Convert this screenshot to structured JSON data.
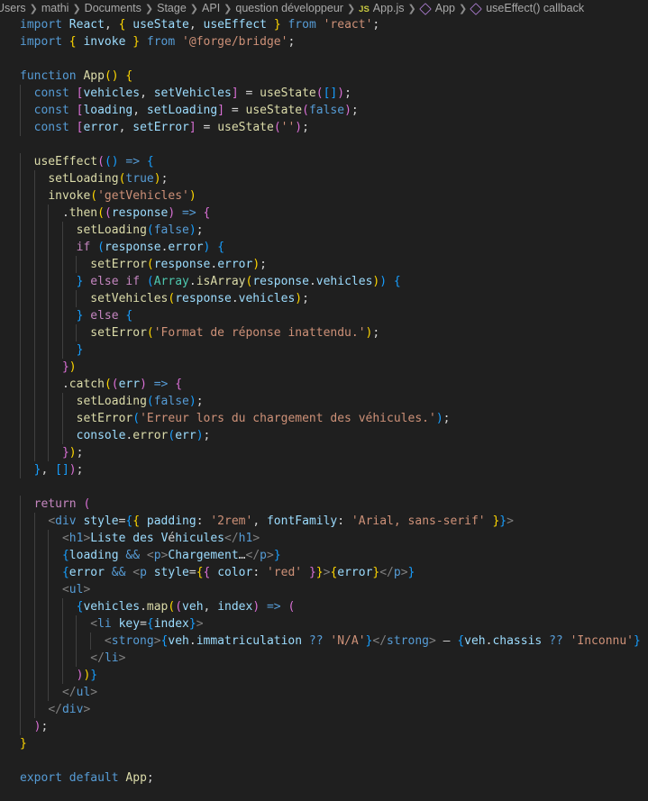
{
  "breadcrumb": {
    "items": [
      "Users",
      "mathi",
      "Documents",
      "Stage",
      "API",
      "question développeur"
    ],
    "file_badge": "JS",
    "file_name": "App.js",
    "symbols": [
      "App",
      "useEffect() callback"
    ]
  },
  "code": {
    "lines": [
      "import React, { useState, useEffect } from 'react';",
      "import { invoke } from '@forge/bridge';",
      "",
      "function App() {",
      "  const [vehicles, setVehicles] = useState([]);",
      "  const [loading, setLoading] = useState(false);",
      "  const [error, setError] = useState('');",
      "",
      "  useEffect(() => {",
      "    setLoading(true);",
      "    invoke('getVehicles')",
      "      .then((response) => {",
      "        setLoading(false);",
      "        if (response.error) {",
      "          setError(response.error);",
      "        } else if (Array.isArray(response.vehicles)) {",
      "          setVehicles(response.vehicles);",
      "        } else {",
      "          setError('Format de réponse inattendu.');",
      "        }",
      "      })",
      "      .catch((err) => {",
      "        setLoading(false);",
      "        setError('Erreur lors du chargement des véhicules.');",
      "        console.error(err);",
      "      });",
      "  }, []);",
      "",
      "  return (",
      "    <div style={{ padding: '2rem', fontFamily: 'Arial, sans-serif' }}>",
      "      <h1>Liste des Véhicules</h1>",
      "      {loading && <p>Chargement…</p>}",
      "      {error && <p style={{ color: 'red' }}>{error}</p>}",
      "      <ul>",
      "        {vehicles.map((veh, index) => (",
      "          <li key={index}>",
      "            <strong>{veh.immatriculation ?? 'N/A'}</strong> – {veh.chassis ?? 'Inconnu'}",
      "          </li>",
      "        ))}",
      "      </ul>",
      "    </div>",
      "  );",
      "}",
      "",
      "export default App;"
    ]
  },
  "colors": {
    "background": "#1f1f1f",
    "keyword": "#569cd6",
    "control_keyword": "#c586c0",
    "function": "#dcdcaa",
    "variable": "#9cdcfe",
    "string": "#ce9178",
    "type": "#4ec9b0",
    "bracket_gold": "#ffd700",
    "bracket_orchid": "#da70d6",
    "bracket_blue": "#179fff"
  },
  "icons": {
    "file_type": "javascript-file-icon",
    "symbol": "symbol-method-icon",
    "separator": "chevron-right-icon"
  }
}
